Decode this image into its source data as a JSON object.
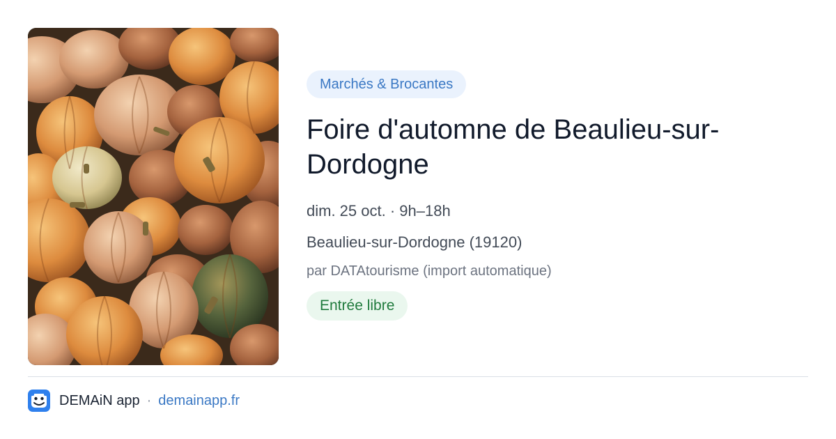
{
  "event": {
    "category": "Marchés & Brocantes",
    "title": "Foire d'automne de Beaulieu-sur-Dordogne",
    "date": "dim. 25 oct. · 9h–18h",
    "location": "Beaulieu-sur-Dordogne (19120)",
    "source": "par DATAtourisme (import automatique)",
    "price": "Entrée libre",
    "image": "pumpkins-photo"
  },
  "footer": {
    "app_name": "DEMAiN app",
    "separator": "·",
    "url": "demainapp.fr",
    "logo_icon": "demain-app-logo-icon"
  },
  "colors": {
    "accent": "#3a78c4",
    "category_bg": "#eaf2fd",
    "price_bg": "#eaf7ee",
    "price_text": "#1f7a3c",
    "title": "#111a2b"
  }
}
